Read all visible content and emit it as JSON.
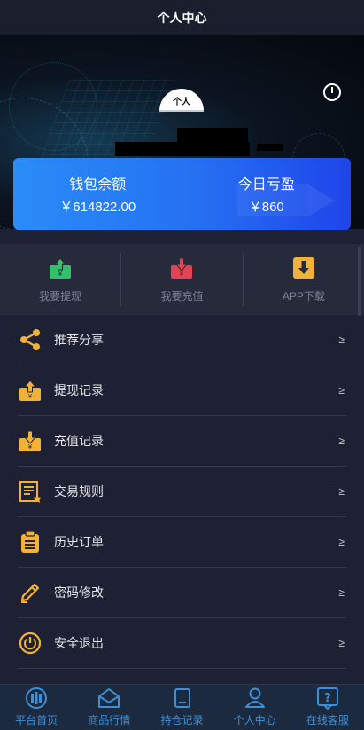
{
  "header": {
    "title": "个人中心"
  },
  "hero": {
    "avatar_text": "个人"
  },
  "wallet": {
    "balance_label": "钱包余额",
    "balance_value": "￥614822.00",
    "today_label": "今日亏盈",
    "today_value": "￥860"
  },
  "actions": [
    {
      "label": "我要提现",
      "icon": "withdraw-icon",
      "color": "#2fc26b"
    },
    {
      "label": "我要充值",
      "icon": "deposit-icon",
      "color": "#e5434f"
    },
    {
      "label": "APP下载",
      "icon": "download-icon",
      "color": "#f2b237"
    }
  ],
  "menu": [
    {
      "label": "推荐分享",
      "icon": "share-icon",
      "chevron": "≥"
    },
    {
      "label": "提现记录",
      "icon": "withdraw-record-icon",
      "chevron": "≥"
    },
    {
      "label": "充值记录",
      "icon": "deposit-record-icon",
      "chevron": "≥"
    },
    {
      "label": "交易规则",
      "icon": "rules-icon",
      "chevron": "≥"
    },
    {
      "label": "历史订单",
      "icon": "clipboard-icon",
      "chevron": "≥"
    },
    {
      "label": "密码修改",
      "icon": "pencil-icon",
      "chevron": "≥"
    },
    {
      "label": "安全退出",
      "icon": "power-icon",
      "chevron": "≥"
    }
  ],
  "tabs": [
    {
      "label": "平台首页",
      "icon": "home-icon"
    },
    {
      "label": "商品行情",
      "icon": "market-icon"
    },
    {
      "label": "持仓记录",
      "icon": "position-icon"
    },
    {
      "label": "个人中心",
      "icon": "user-icon"
    },
    {
      "label": "在线客服",
      "icon": "help-icon"
    }
  ],
  "colors": {
    "accent": "#f2b237",
    "tab": "#3f8fd6",
    "wallet_start": "#2a8cf7",
    "wallet_end": "#1f45ea"
  }
}
